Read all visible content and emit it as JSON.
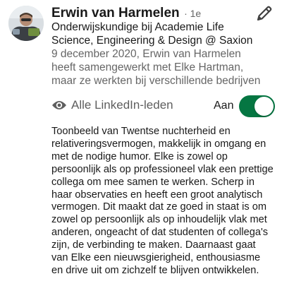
{
  "profile": {
    "name": "Erwin van Harmelen",
    "degree": "· 1e",
    "headline": "Onderwijskundige bij Academie Life Science, Engineering & Design @ Saxion",
    "meta": "9 december 2020, Erwin van Harmelen heeft samengewerkt met Elke Hartman, maar ze werkten bij verschillende bedrijven"
  },
  "visibility": {
    "label": "Alle LinkedIn-leden",
    "icon": "eye-icon"
  },
  "toggle": {
    "label": "Aan",
    "state": "on",
    "color": "#057642"
  },
  "recommendation": {
    "text": "Toonbeeld van Twentse nuchterheid en relativeringsvermogen, makkelijk in omgang en met de nodige humor. Elke is zowel op persoonlijk als op professioneel vlak een prettige collega om mee samen te werken. Scherp in haar observaties en heeft een groot analytisch vermogen. Dit maakt dat ze goed in staat is om zowel op persoonlijk als op inhoudelijk vlak met anderen, ongeacht of dat studenten of collega's zijn, de verbinding te maken. Daarnaast gaat van Elke een nieuwsgierigheid, enthousiasme en drive uit om zichzelf te blijven ontwikkelen."
  },
  "icons": {
    "edit": "pencil-icon",
    "avatar": "avatar"
  }
}
